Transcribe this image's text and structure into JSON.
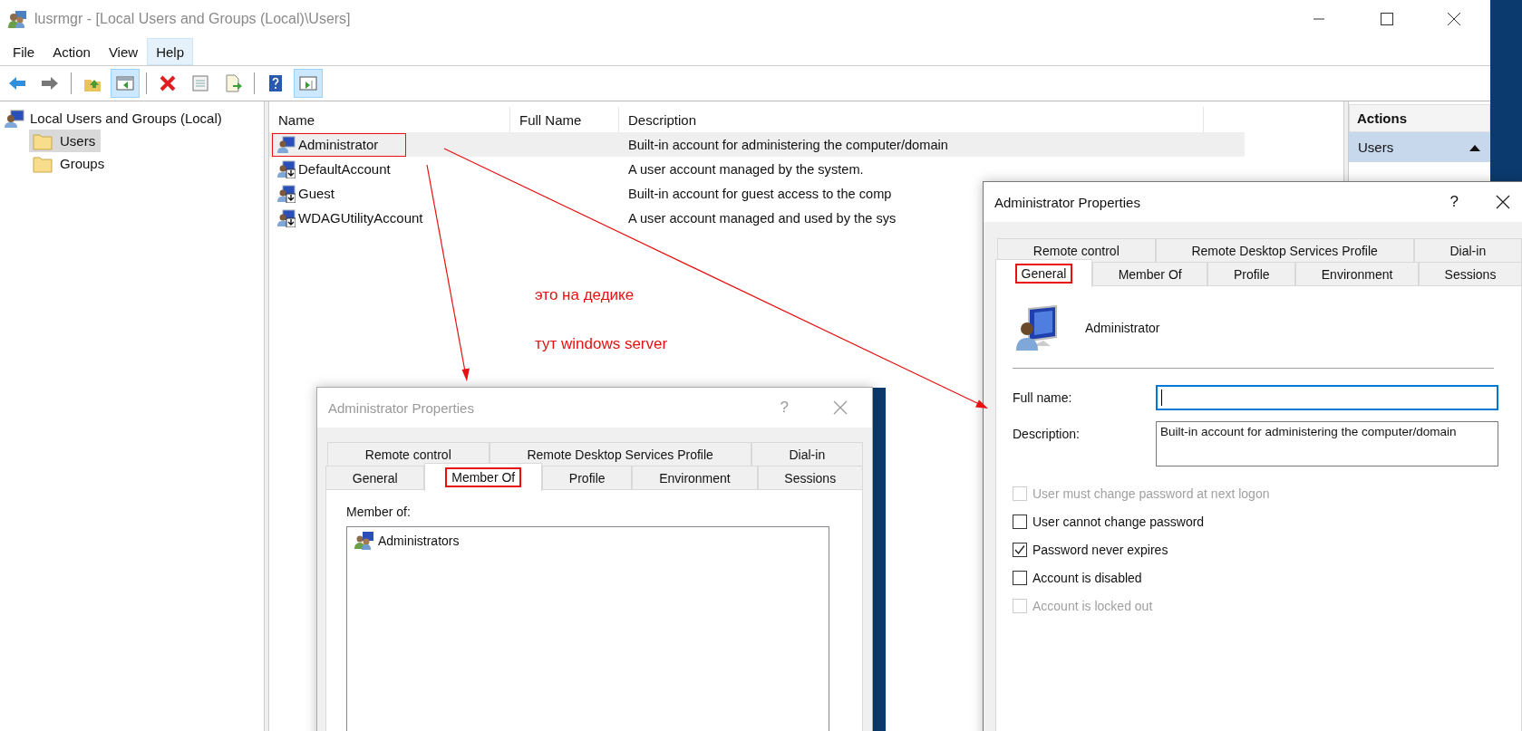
{
  "window": {
    "title": "lusrmgr - [Local Users and Groups (Local)\\Users]"
  },
  "menu": [
    {
      "label": "File",
      "selected": false
    },
    {
      "label": "Action",
      "selected": false
    },
    {
      "label": "View",
      "selected": false
    },
    {
      "label": "Help",
      "selected": true
    }
  ],
  "toolbar_groups": [
    {
      "buttons": [
        {
          "kind": "back",
          "pressed": false
        },
        {
          "kind": "forward",
          "pressed": false
        }
      ]
    },
    {
      "buttons": [
        {
          "kind": "up",
          "pressed": false
        },
        {
          "kind": "tree",
          "pressed": true
        }
      ]
    },
    {
      "buttons": [
        {
          "kind": "delete",
          "pressed": false
        },
        {
          "kind": "properties",
          "pressed": false
        },
        {
          "kind": "export",
          "pressed": false
        }
      ]
    },
    {
      "buttons": [
        {
          "kind": "help",
          "pressed": false
        },
        {
          "kind": "actionpane",
          "pressed": true
        }
      ]
    }
  ],
  "tree": {
    "label": "Local Users and Groups (Local)",
    "children": [
      {
        "label": "Users",
        "selected": true
      },
      {
        "label": "Groups",
        "selected": false
      }
    ]
  },
  "table": {
    "columns": [
      "Name",
      "Full Name",
      "Description"
    ],
    "rows": [
      {
        "name": "Administrator",
        "description": "Built-in account for administering the computer/domain",
        "selected": true,
        "disabled": false,
        "annotated": true
      },
      {
        "name": "DefaultAccount",
        "description": "A user account managed by the system.",
        "selected": false,
        "disabled": true,
        "annotated": false
      },
      {
        "name": "Guest",
        "description": "Built-in account for guest access to the comp",
        "selected": false,
        "disabled": true,
        "annotated": false
      },
      {
        "name": "WDAGUtilityAccount",
        "description": "A user account managed and used by the sys",
        "selected": false,
        "disabled": true,
        "annotated": false
      }
    ]
  },
  "actions": {
    "title": "Actions",
    "section": "Users"
  },
  "notes": [
    "это на дедике",
    "тут windows server"
  ],
  "dialogs": [
    {
      "title": "Administrator Properties",
      "active": true,
      "help": "?",
      "tab_rows": [
        [
          {
            "label": "Remote control",
            "selected": false,
            "annotated": false
          },
          {
            "label": "Remote Desktop Services Profile",
            "selected": false,
            "annotated": false
          },
          {
            "label": "Dial-in",
            "selected": false,
            "annotated": false
          }
        ],
        [
          {
            "label": "General",
            "selected": true,
            "annotated": true
          },
          {
            "label": "Member Of",
            "selected": false,
            "annotated": false
          },
          {
            "label": "Profile",
            "selected": false,
            "annotated": false
          },
          {
            "label": "Environment",
            "selected": false,
            "annotated": false
          },
          {
            "label": "Sessions",
            "selected": false,
            "annotated": false
          }
        ]
      ],
      "content": {
        "kind": "general",
        "user_name": "Administrator",
        "fields": [
          {
            "label": "Full name:",
            "focused": true
          },
          {
            "label": "Description:",
            "value": "Built-in account for administering the computer/domain",
            "focused": false
          }
        ],
        "checkboxes": [
          {
            "label": "User must change password at next logon",
            "checked": false,
            "disabled": true
          },
          {
            "label": "User cannot change password",
            "checked": false,
            "disabled": false
          },
          {
            "label": "Password never expires",
            "checked": true,
            "disabled": false
          },
          {
            "label": "Account is disabled",
            "checked": false,
            "disabled": false
          },
          {
            "label": "Account is locked out",
            "checked": false,
            "disabled": true
          }
        ]
      }
    },
    {
      "title": "Administrator Properties",
      "active": false,
      "help": "?",
      "tab_rows": [
        [
          {
            "label": "Remote control",
            "selected": false,
            "annotated": false
          },
          {
            "label": "Remote Desktop Services Profile",
            "selected": false,
            "annotated": false
          },
          {
            "label": "Dial-in",
            "selected": false,
            "annotated": false
          }
        ],
        [
          {
            "label": "General",
            "selected": false,
            "annotated": false
          },
          {
            "label": "Member Of",
            "selected": true,
            "annotated": true
          },
          {
            "label": "Profile",
            "selected": false,
            "annotated": false
          },
          {
            "label": "Environment",
            "selected": false,
            "annotated": false
          },
          {
            "label": "Sessions",
            "selected": false,
            "annotated": false
          }
        ]
      ],
      "content": {
        "kind": "member_of",
        "label": "Member of:",
        "items": [
          "Administrators"
        ]
      }
    }
  ]
}
